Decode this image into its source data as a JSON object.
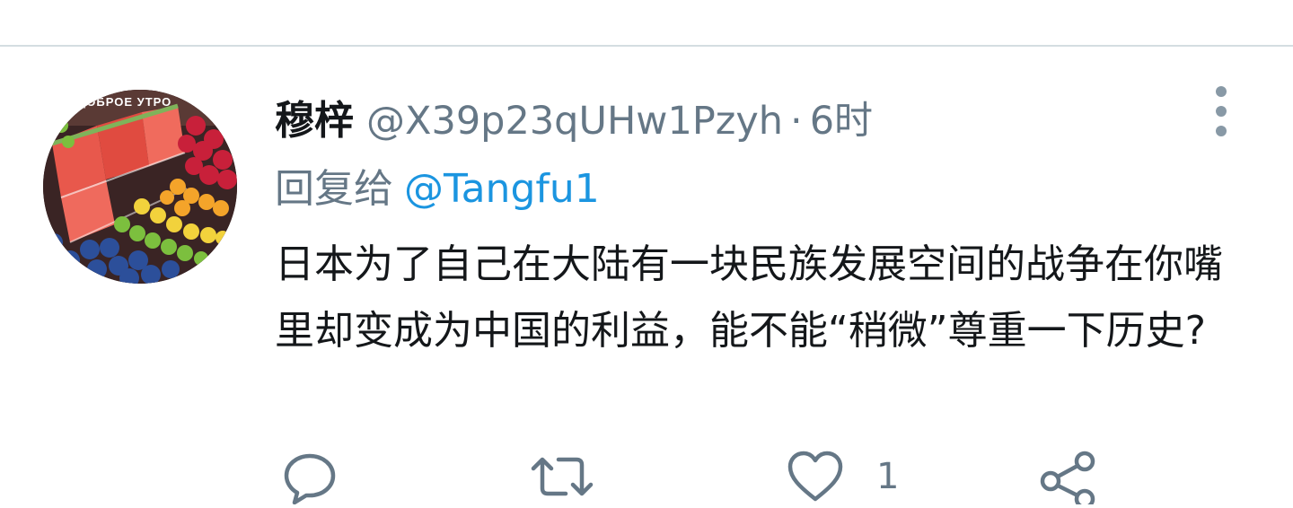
{
  "tweet": {
    "display_name": "穆梓",
    "handle": "@X39p23qUHw1Pzyh",
    "separator": "·",
    "time": "6时",
    "reply_prefix": "回复给",
    "reply_mention": "@Tangfu1",
    "text": "日本为了自己在大陆有一块民族发展空间的战争在你嘴里却变成为中国的利益，能不能“稍微”尊重一下历史?",
    "avatar_caption": "ДОБРОЕ УТРО"
  },
  "actions": {
    "reply_icon": "speech-bubble-icon",
    "retweet_icon": "retweet-arrows-icon",
    "like_icon": "heart-icon",
    "like_count": "1",
    "share_icon": "share-nodes-icon"
  },
  "colors": {
    "text_primary": "#14171a",
    "text_secondary": "#657786",
    "accent": "#1b95e0",
    "divider": "#d4dde1"
  }
}
